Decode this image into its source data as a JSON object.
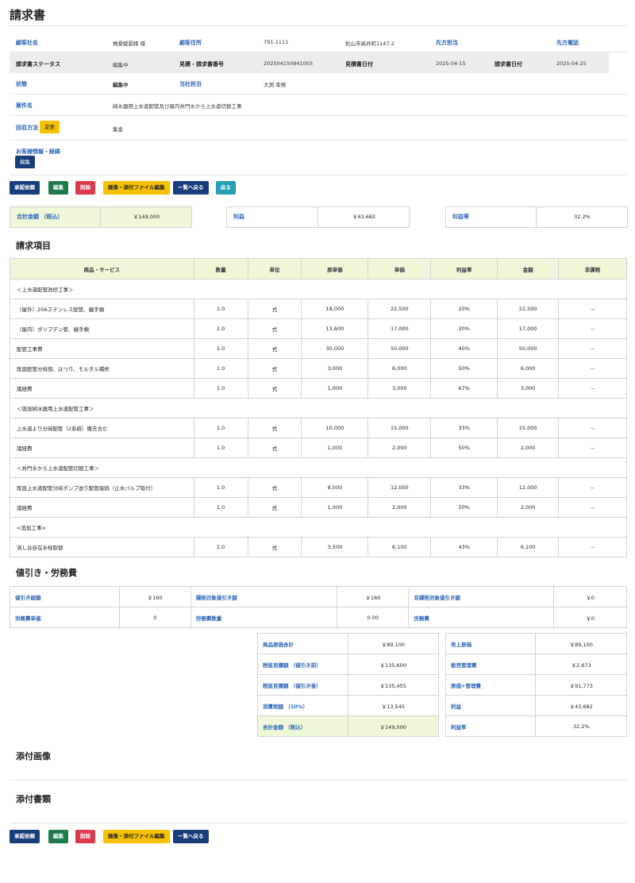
{
  "page_title": "請求書",
  "info": {
    "customer_name_label": "顧客社名",
    "customer_name": "株愛媛園様 様",
    "customer_address_label": "顧客住所",
    "postal_code": "791-1111",
    "address": "松山市高井町1147-2",
    "client_contact_label": "先方担当",
    "client_phone_label": "先方電話",
    "invoice_status_label": "請求書ステータス",
    "invoice_status": "編集中",
    "estimate_no_label": "見積・請求書番号",
    "estimate_no": "202504150941003",
    "estimate_date_label": "見積書日付",
    "estimate_date": "2025-04-15",
    "invoice_date_label": "請求書日付",
    "invoice_date": "2025-04-25",
    "state_label": "状態",
    "state": "編集中",
    "our_staff_label": "当社担当",
    "our_staff": "大渕 幸規",
    "project_label": "案件名",
    "project": "純水器用上水道配管及び屋内井門水から上水道切替工事",
    "collection_label": "回収方法",
    "collection_change_button": "変更",
    "collection": "集金",
    "customer_notes_label": "お客様情報・経緯",
    "customer_notes_edit_button": "編集"
  },
  "actions": {
    "approve": "承認依頼",
    "edit": "編集",
    "delete": "削除",
    "attachments": "画像・添付ファイル編集",
    "back_to_list": "一覧へ戻る",
    "back": "戻る"
  },
  "summary": {
    "total_label": "合計金額 （税込）",
    "total": "￥149,000",
    "profit_label": "利益",
    "profit": "￥43,682",
    "margin_label": "利益率",
    "margin": "32.2%"
  },
  "items_heading": "請求項目",
  "items_headers": [
    "商品・サービス",
    "数量",
    "単位",
    "原単価",
    "単価",
    "利益率",
    "金額",
    "非課税"
  ],
  "items": [
    {
      "section": "＜上水道配管改修工事＞"
    },
    {
      "name": "（屋外）20Aステンレス配管、継手類",
      "qty": "1.0",
      "unit": "式",
      "cost": "18,000",
      "price": "22,500",
      "margin": "20%",
      "amount": "22,500",
      "tax_exempt": "--"
    },
    {
      "name": "（屋内）ポリブデン管、継手類",
      "qty": "1.0",
      "unit": "式",
      "cost": "13,600",
      "price": "17,000",
      "margin": "20%",
      "amount": "17,000",
      "tax_exempt": "--"
    },
    {
      "name": "配管工事費",
      "qty": "1.0",
      "unit": "式",
      "cost": "30,000",
      "price": "50,000",
      "margin": "40%",
      "amount": "50,000",
      "tax_exempt": "--"
    },
    {
      "name": "既設配管分岐部、はつり、モルタル補修",
      "qty": "1.0",
      "unit": "式",
      "cost": "3,000",
      "price": "6,000",
      "margin": "50%",
      "amount": "6,000",
      "tax_exempt": "--"
    },
    {
      "name": "諸経費",
      "qty": "1.0",
      "unit": "式",
      "cost": "1,000",
      "price": "3,000",
      "margin": "67%",
      "amount": "3,000",
      "tax_exempt": "--"
    },
    {
      "section": "＜仮設純水器用上水道配管工事＞"
    },
    {
      "name": "上水道より分岐配管（2系統）撤去含む",
      "qty": "1.0",
      "unit": "式",
      "cost": "10,000",
      "price": "15,000",
      "margin": "33%",
      "amount": "15,000",
      "tax_exempt": "--"
    },
    {
      "name": "諸経費",
      "qty": "1.0",
      "unit": "式",
      "cost": "1,000",
      "price": "2,000",
      "margin": "50%",
      "amount": "2,000",
      "tax_exempt": "--"
    },
    {
      "section": "＜井門水から上水道配管切替工事＞"
    },
    {
      "name": "既設上水道配管分岐ポンプ送り配管接続（止水バルブ取付）",
      "qty": "1.0",
      "unit": "式",
      "cost": "8,000",
      "price": "12,000",
      "margin": "33%",
      "amount": "12,000",
      "tax_exempt": "--"
    },
    {
      "name": "諸経費",
      "qty": "1.0",
      "unit": "式",
      "cost": "1,000",
      "price": "2,000",
      "margin": "50%",
      "amount": "2,000",
      "tax_exempt": "--"
    },
    {
      "section": "<追加工事>"
    },
    {
      "name": "流し台自在水栓取替",
      "qty": "1.0",
      "unit": "式",
      "cost": "3,500",
      "price": "6,100",
      "margin": "43%",
      "amount": "6,100",
      "tax_exempt": "--"
    }
  ],
  "discount_heading": "値引き・労務費",
  "discount": {
    "total_discount_label": "値引き総額",
    "total_discount": "￥160",
    "taxable_discount_label": "課税対象値引き額",
    "taxable_discount": "￥160",
    "nontaxable_discount_label": "非課税対象値引き額",
    "nontaxable_discount": "￥0",
    "labor_unit_label": "労務費単価",
    "labor_unit": "0",
    "labor_qty_label": "労務費数量",
    "labor_qty": "0.00",
    "labor_cost_label": "労務費",
    "labor_cost": "￥0"
  },
  "totals_left": [
    {
      "label": "商品原価合計",
      "value": "￥89,100"
    },
    {
      "label": "税抜見積額 （値引き前）",
      "value": "￥135,600"
    },
    {
      "label": "税抜見積額 （値引き後）",
      "value": "￥135,455"
    },
    {
      "label": "消費税額 （10%）",
      "value": "￥13,545"
    },
    {
      "label": "合計金額 （税込）",
      "value": "￥149,000"
    }
  ],
  "totals_right": [
    {
      "label": "売上原価",
      "value": "￥89,100"
    },
    {
      "label": "販売管理費",
      "value": "￥2,673"
    },
    {
      "label": "原価+管理費",
      "value": "￥91,773"
    },
    {
      "label": "利益",
      "value": "￥43,682"
    },
    {
      "label": "利益率",
      "value": "32.2%"
    }
  ],
  "attached_images_heading": "添付画像",
  "attached_docs_heading": "添付書類"
}
